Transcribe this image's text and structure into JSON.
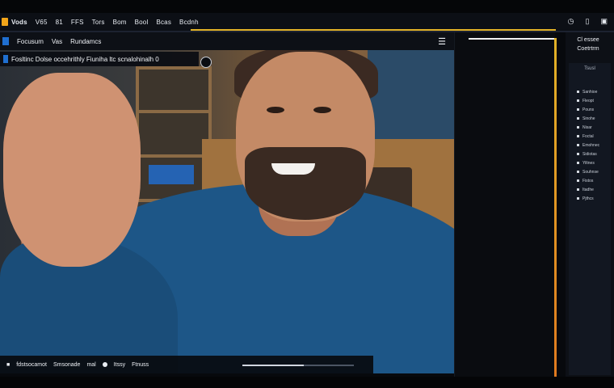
{
  "menubar": {
    "items": [
      "Vods",
      "V65",
      "81",
      "FFS",
      "Tors",
      "Bom",
      "Bool",
      "Bcas",
      "Bcdnh"
    ],
    "right_icons": [
      "clock-icon",
      "bell-icon",
      "user-icon"
    ]
  },
  "subtoolbar": {
    "items": [
      "Focusum",
      "Vas",
      "Rundamcs"
    ]
  },
  "caption": {
    "text": "Fosltinc Dolse occehrithly Fiuniha ltc scnalohinalh 0"
  },
  "controls": {
    "items": [
      "fdstsocamot",
      "Smsonade",
      "mal",
      "Itssy",
      "Ftnuss"
    ],
    "progress": 0.55
  },
  "side_panel": {
    "title_line1": "Cl essee",
    "title_line2": "Coetrtrm",
    "list_header": "Tsusl",
    "rows": [
      "Sanhioe",
      "Fleopt",
      "Pouns",
      "Sinohe",
      "Nisar",
      "Foctal",
      "Emohnec",
      "Sidiotas",
      "Yiltnes",
      "Souhnse",
      "Fistos",
      "Itadhe",
      "Pjthcs"
    ]
  },
  "colors": {
    "accent": "#e2b227",
    "brand": "#1f6fd1",
    "shirt": "#1d5687"
  }
}
